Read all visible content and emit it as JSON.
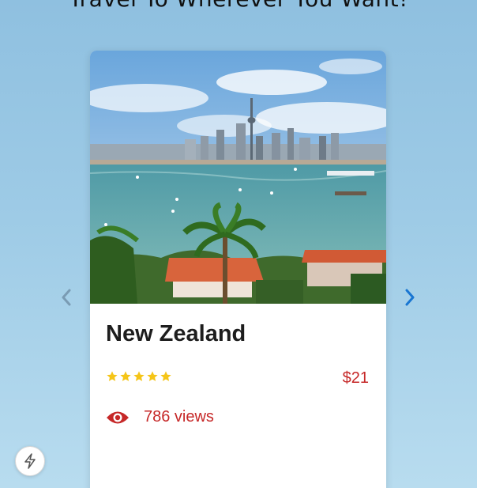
{
  "page": {
    "heading": "Travel To Wherever You Want!"
  },
  "card": {
    "title": "New Zealand",
    "rating": 5,
    "rating_max": 5,
    "price": "$21",
    "views": "786 views",
    "image": "new-zealand-auckland-skyline-photo"
  },
  "carousel": {
    "prev_icon": "chevron-left-icon",
    "next_icon": "chevron-right-icon"
  },
  "fab": {
    "icon": "lightning-bolt-icon"
  },
  "colors": {
    "background_top": "#8fc0e0",
    "background_bottom": "#b8dcef",
    "price_red": "#c62828",
    "star_gold": "#f5c518",
    "next_arrow": "#1976d2",
    "prev_arrow": "#7a9bb3"
  }
}
